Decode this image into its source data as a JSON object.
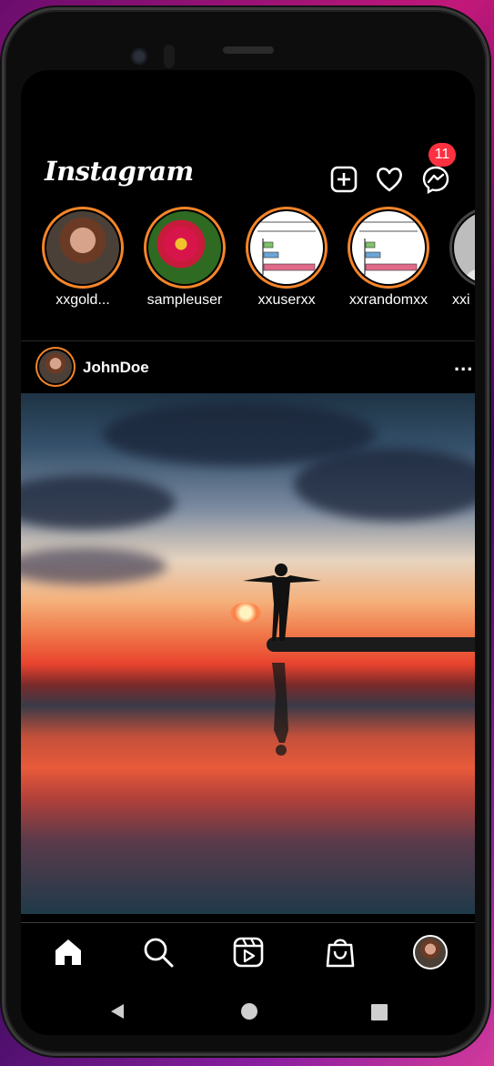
{
  "app": {
    "logo_text": "Instagram",
    "messages_badge": "11"
  },
  "header_icons": [
    "new-post-icon",
    "heart-icon",
    "messenger-icon"
  ],
  "stories": [
    {
      "username": "xxgold...",
      "avatar": "woman-portrait"
    },
    {
      "username": "sampleuser",
      "avatar": "red-flower"
    },
    {
      "username": "xxuserxx",
      "avatar": "bar-chart-drawing"
    },
    {
      "username": "xxrandomxx",
      "avatar": "bar-chart-drawing"
    },
    {
      "username": "xxi",
      "avatar": "default-avatar"
    }
  ],
  "post": {
    "username": "JohnDoe",
    "more_label": "...",
    "image": "person-silhouette-at-sunset-beach"
  },
  "bottom_nav": [
    "home-icon",
    "search-icon",
    "reels-icon",
    "shop-icon",
    "profile-avatar"
  ],
  "system_nav": [
    "back-icon",
    "home-circle-icon",
    "recents-icon"
  ],
  "colors": {
    "story_ring": "#f58529",
    "badge": "#ff3040",
    "background": "#000000"
  }
}
